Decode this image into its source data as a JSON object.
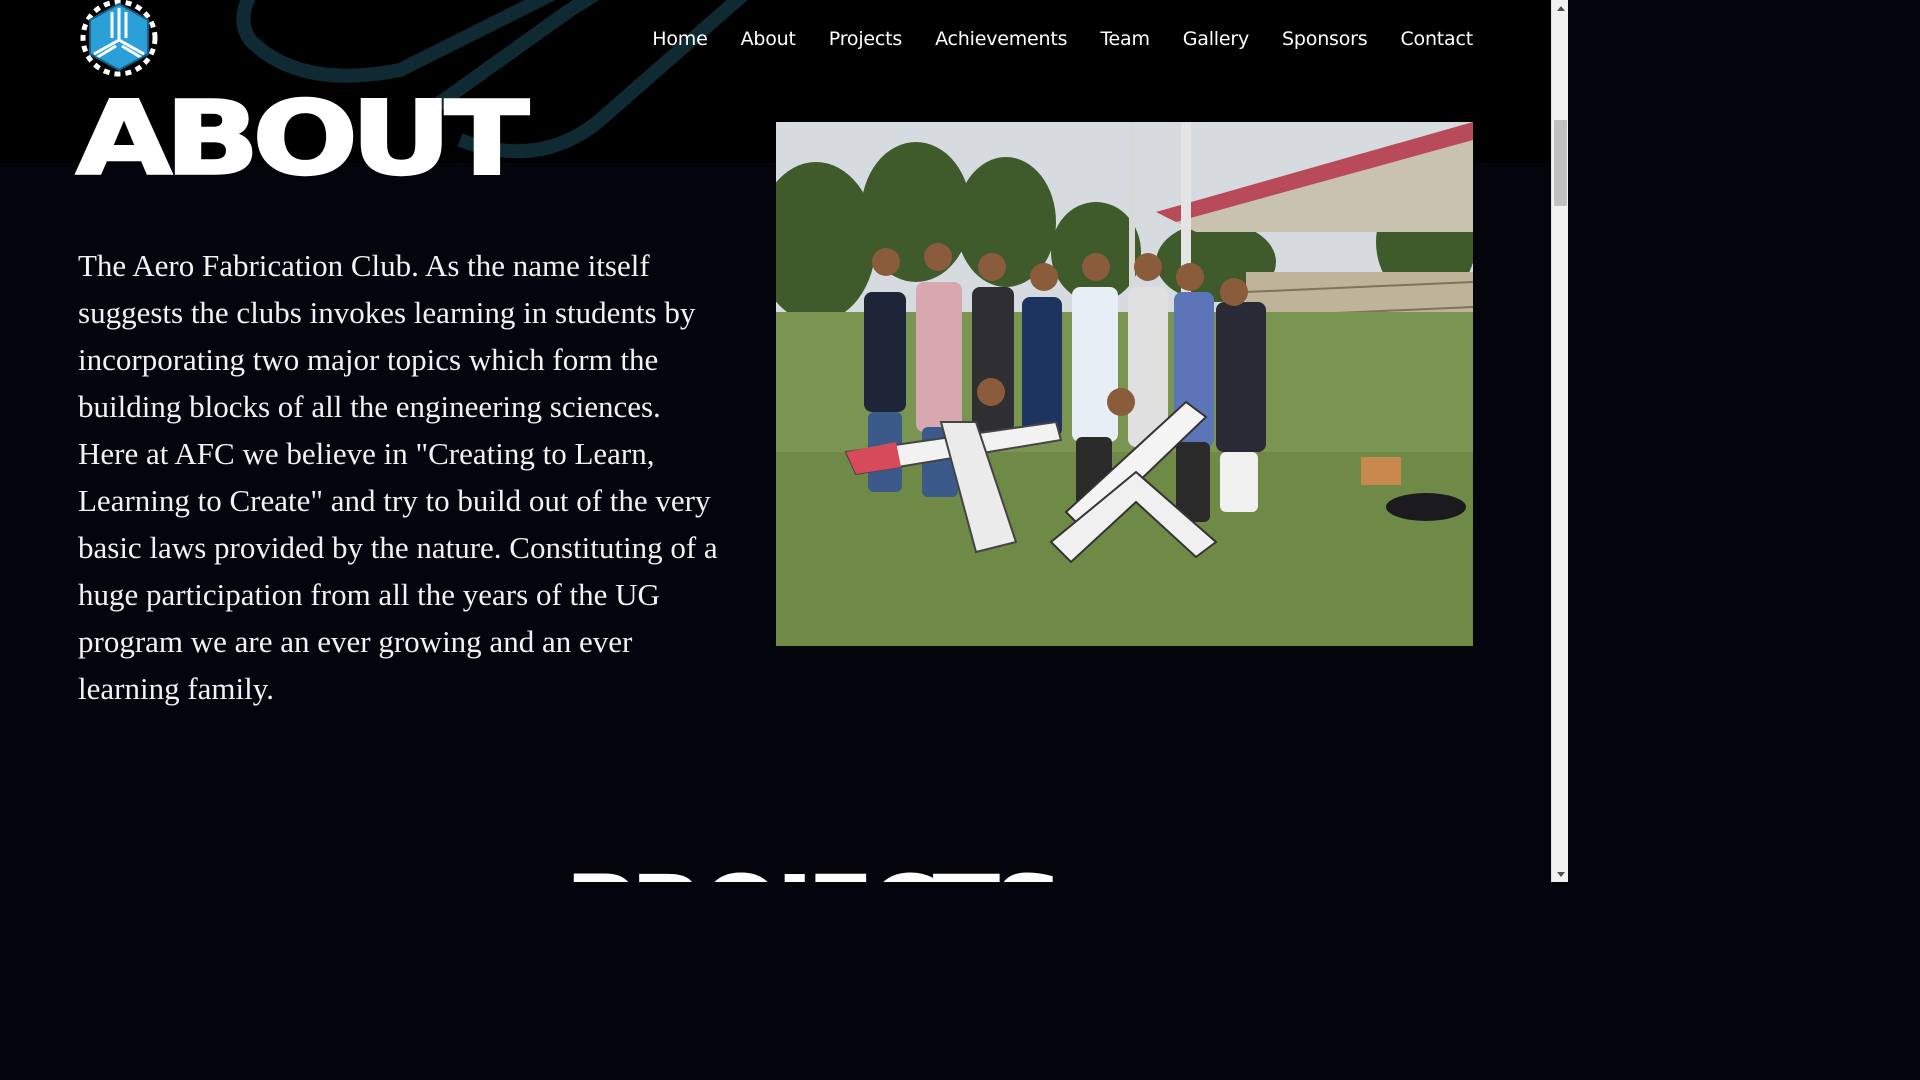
{
  "nav": {
    "logo_alt": "AFC logo",
    "items": [
      {
        "label": "Home"
      },
      {
        "label": "About"
      },
      {
        "label": "Projects"
      },
      {
        "label": "Achievements"
      },
      {
        "label": "Team"
      },
      {
        "label": "Gallery"
      },
      {
        "label": "Sponsors"
      },
      {
        "label": "Contact"
      }
    ]
  },
  "about": {
    "title": "ABOUT",
    "body": "The Aero Fabrication Club. As the name itself suggests the clubs invokes learning in students by incorporating two major topics which form the building blocks of all the engineering sciences. Here at AFC we believe in \"Creating to Learn, Learning to Create\" and try to build out of the very basic laws provided by the nature. Constituting of a huge participation from all the years of the UG program we are an ever growing and an ever learning family.",
    "photo_alt": "Club members with model aircraft on a sports field"
  },
  "projects": {
    "title": "PROJECTS"
  },
  "colors": {
    "background": "#04040d",
    "hero_band": "#000000",
    "accent_blue": "#2a9fd8",
    "text": "#ffffff"
  },
  "icons": {
    "logo": "gear-tri-blade-logo",
    "scroll_up": "triangle-up-icon",
    "scroll_down": "triangle-down-icon"
  }
}
